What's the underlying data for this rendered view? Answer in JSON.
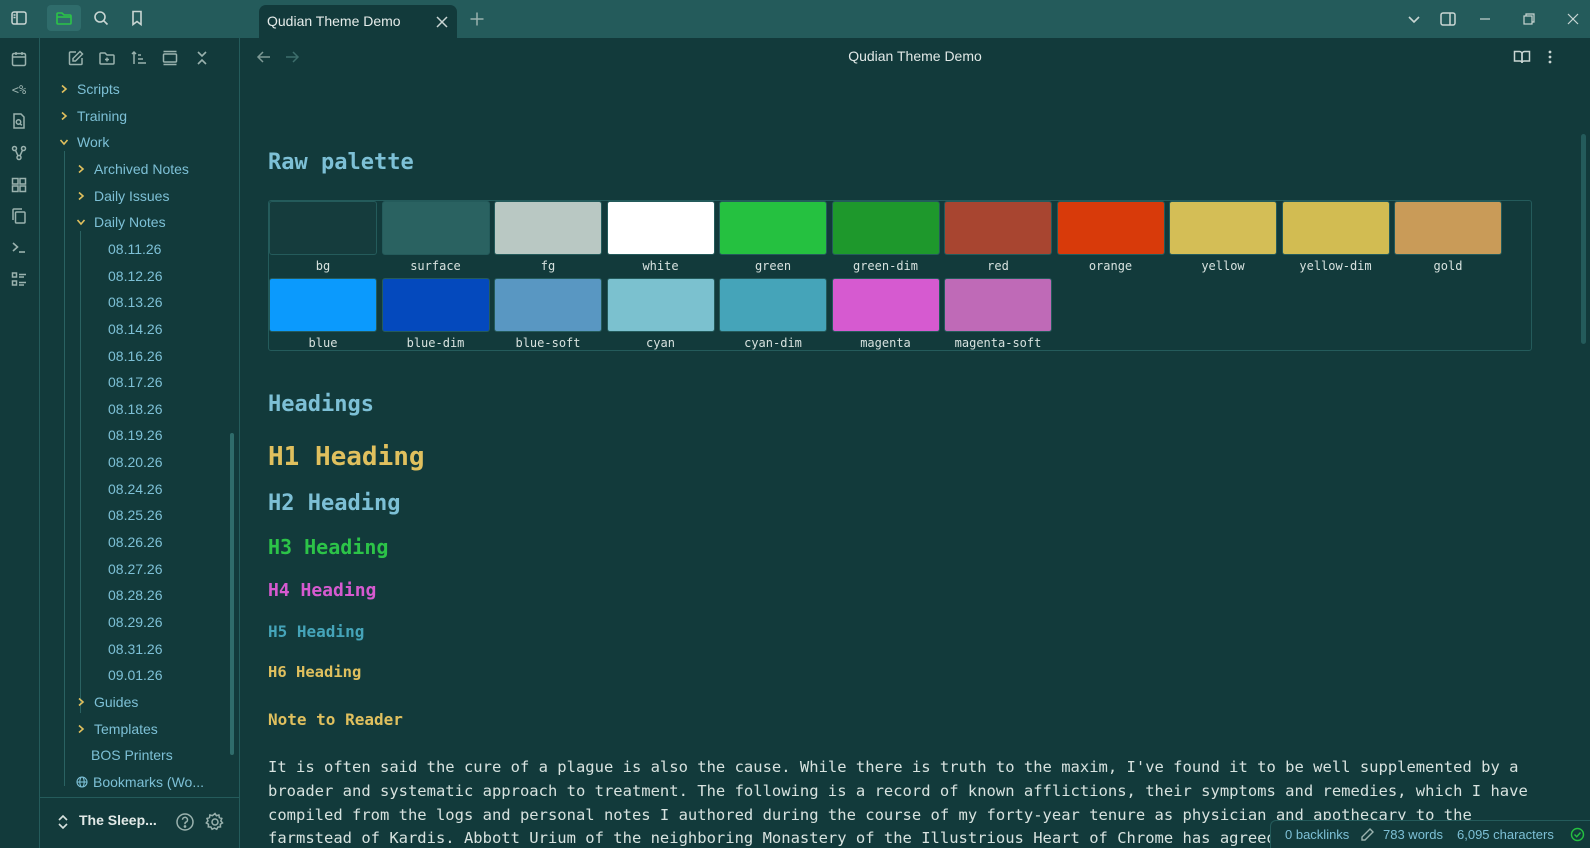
{
  "app": {
    "window_title": "Qudian Theme Demo"
  },
  "tab": {
    "title": "Qudian Theme Demo"
  },
  "ribbon": {
    "icons": [
      "calendar-icon",
      "templater-icon",
      "search-note-icon",
      "graph-icon",
      "canvas-icon",
      "copy-icon",
      "terminal-icon",
      "list-icon"
    ],
    "templater_glyph": "<%"
  },
  "sidebar": {
    "tree": [
      {
        "label": "Scripts",
        "depth": 0,
        "state": "collapsed"
      },
      {
        "label": "Training",
        "depth": 0,
        "state": "collapsed"
      },
      {
        "label": "Work",
        "depth": 0,
        "state": "expanded"
      },
      {
        "label": "Archived Notes",
        "depth": 1,
        "state": "collapsed"
      },
      {
        "label": "Daily Issues",
        "depth": 1,
        "state": "collapsed"
      },
      {
        "label": "Daily Notes",
        "depth": 1,
        "state": "expanded"
      },
      {
        "label": "08.11.26",
        "depth": 2,
        "state": "file"
      },
      {
        "label": "08.12.26",
        "depth": 2,
        "state": "file"
      },
      {
        "label": "08.13.26",
        "depth": 2,
        "state": "file"
      },
      {
        "label": "08.14.26",
        "depth": 2,
        "state": "file"
      },
      {
        "label": "08.16.26",
        "depth": 2,
        "state": "file"
      },
      {
        "label": "08.17.26",
        "depth": 2,
        "state": "file"
      },
      {
        "label": "08.18.26",
        "depth": 2,
        "state": "file"
      },
      {
        "label": "08.19.26",
        "depth": 2,
        "state": "file"
      },
      {
        "label": "08.20.26",
        "depth": 2,
        "state": "file"
      },
      {
        "label": "08.24.26",
        "depth": 2,
        "state": "file"
      },
      {
        "label": "08.25.26",
        "depth": 2,
        "state": "file"
      },
      {
        "label": "08.26.26",
        "depth": 2,
        "state": "file"
      },
      {
        "label": "08.27.26",
        "depth": 2,
        "state": "file"
      },
      {
        "label": "08.28.26",
        "depth": 2,
        "state": "file"
      },
      {
        "label": "08.29.26",
        "depth": 2,
        "state": "file"
      },
      {
        "label": "08.31.26",
        "depth": 2,
        "state": "file"
      },
      {
        "label": "09.01.26",
        "depth": 2,
        "state": "file"
      },
      {
        "label": "Guides",
        "depth": 1,
        "state": "collapsed"
      },
      {
        "label": "Templates",
        "depth": 1,
        "state": "collapsed"
      },
      {
        "label": "BOS Printers",
        "depth": 1,
        "state": "file"
      },
      {
        "label": "Bookmarks (Wo...",
        "depth": 0,
        "state": "web"
      }
    ],
    "vault_name": "The Sleep..."
  },
  "view": {
    "title": "Qudian Theme Demo"
  },
  "doc": {
    "palette_heading": "Raw palette",
    "palette": [
      {
        "name": "bg",
        "color": "#153c3d"
      },
      {
        "name": "surface",
        "color": "#2a6261"
      },
      {
        "name": "fg",
        "color": "#b9c8c3"
      },
      {
        "name": "white",
        "color": "#ffffff"
      },
      {
        "name": "green",
        "color": "#25c140"
      },
      {
        "name": "green-dim",
        "color": "#1e982c"
      },
      {
        "name": "red",
        "color": "#a84530"
      },
      {
        "name": "orange",
        "color": "#d83a0a"
      },
      {
        "name": "yellow",
        "color": "#d4be56"
      },
      {
        "name": "yellow-dim",
        "color": "#d2bc52"
      },
      {
        "name": "gold",
        "color": "#c99b58"
      },
      {
        "name": "blue",
        "color": "#0b9afd"
      },
      {
        "name": "blue-dim",
        "color": "#0449bd"
      },
      {
        "name": "blue-soft",
        "color": "#5997c2"
      },
      {
        "name": "cyan",
        "color": "#7bc1cf"
      },
      {
        "name": "cyan-dim",
        "color": "#45a4b9"
      },
      {
        "name": "magenta",
        "color": "#d65ad0"
      },
      {
        "name": "magenta-soft",
        "color": "#bf6ab7"
      }
    ],
    "headings_title": "Headings",
    "headings": [
      {
        "text": "H1 Heading",
        "color": "#e0c05e"
      },
      {
        "text": "H2 Heading",
        "color": "#7dc0d6"
      },
      {
        "text": "H3 Heading",
        "color": "#2cc348"
      },
      {
        "text": "H4 Heading",
        "color": "#d65ad0"
      },
      {
        "text": "H5 Heading",
        "color": "#45a4b9"
      },
      {
        "text": "H6 Heading",
        "color": "#e0c05e"
      }
    ],
    "note_heading": "Note to Reader",
    "paragraph": "It is often said the cure of a plague is also the cause. While there is truth to the maxim, I've found it to be well supplemented by a broader and systematic approach to treatment. The following is a record of known afflictions, their symptoms and remedies, which I have compiled from the logs and personal notes I authored during the course of my forty-year tenure as physician and apothecary to the farmstead of Kardis. Abbott Urium of the neighboring Monastery of the Illustrious Heart of Chrome has agreed to instruct the monks of the scriptorium to reproduce this text for posterity; the reader who finds use in these notes is"
  },
  "status": {
    "backlinks": "0 backlinks",
    "words": "783 words",
    "characters": "6,095 characters"
  },
  "colors": {
    "accent": "#7dc0d6",
    "panel": "#123a3b",
    "bar": "#245b5b",
    "ok": "#25c140"
  }
}
